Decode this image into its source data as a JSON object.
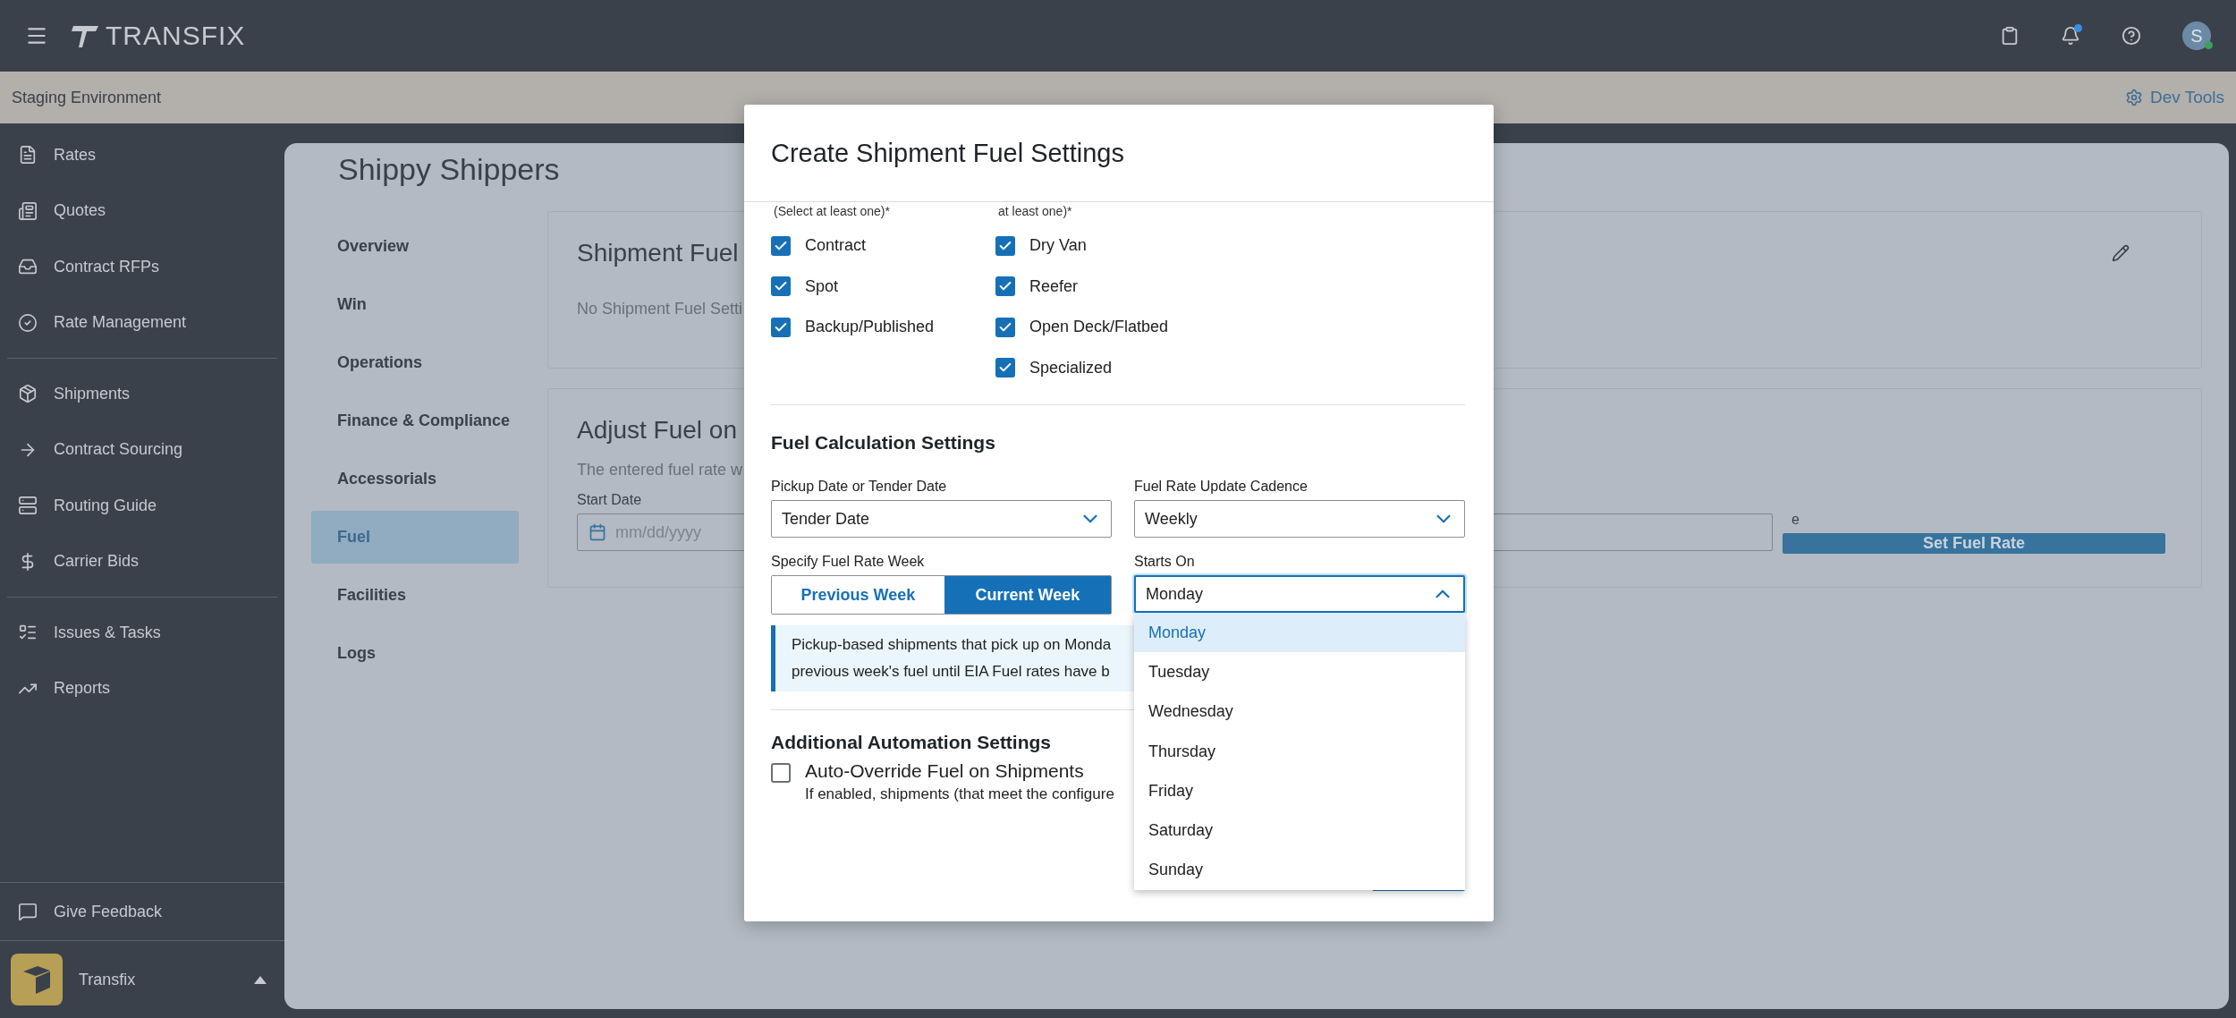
{
  "header": {
    "brand": "TRANSFIX",
    "notifications_unread": true,
    "avatar": {
      "initial": "S",
      "online": true
    }
  },
  "env_bar": {
    "label": "Staging Environment",
    "dev_tools": "Dev Tools"
  },
  "sidebar": {
    "groups": [
      [
        {
          "label": "Rates"
        },
        {
          "label": "Quotes"
        },
        {
          "label": "Contract RFPs"
        },
        {
          "label": "Rate Management"
        }
      ],
      [
        {
          "label": "Shipments"
        },
        {
          "label": "Contract Sourcing"
        },
        {
          "label": "Routing Guide"
        },
        {
          "label": "Carrier Bids"
        }
      ],
      [
        {
          "label": "Issues & Tasks"
        },
        {
          "label": "Reports"
        }
      ]
    ],
    "feedback": "Give Feedback",
    "account": {
      "name": "Transfix",
      "expanded": true
    }
  },
  "page": {
    "title": "Shippy Shippers",
    "tabs": [
      {
        "label": "Overview",
        "selected": false
      },
      {
        "label": "Win",
        "selected": false
      },
      {
        "label": "Operations",
        "selected": false
      },
      {
        "label": "Finance & Compliance",
        "selected": false
      },
      {
        "label": "Accessorials",
        "selected": false
      },
      {
        "label": "Fuel",
        "selected": true
      },
      {
        "label": "Facilities",
        "selected": false
      },
      {
        "label": "Logs",
        "selected": false
      }
    ],
    "settings_card": {
      "title": "Shipment Fuel",
      "empty_text": "No Shipment Fuel Setti"
    },
    "adjust_card": {
      "title": "Adjust Fuel on",
      "description": "The entered fuel rate w",
      "start_date_label": "Start Date",
      "start_date_placeholder": "mm/dd/yyyy",
      "column_2_label": "e",
      "button": "Set Fuel Rate"
    }
  },
  "modal": {
    "title": "Create Shipment Fuel Settings",
    "checkbox_columns": [
      {
        "hint": "(Select at least one)*",
        "options": [
          {
            "label": "Contract",
            "checked": true
          },
          {
            "label": "Spot",
            "checked": true
          },
          {
            "label": "Backup/Published",
            "checked": true
          }
        ]
      },
      {
        "hint": "at least one)*",
        "options": [
          {
            "label": "Dry Van",
            "checked": true
          },
          {
            "label": "Reefer",
            "checked": true
          },
          {
            "label": "Open Deck/Flatbed",
            "checked": true
          },
          {
            "label": "Specialized",
            "checked": true
          }
        ]
      }
    ],
    "calc_title": "Fuel Calculation Settings",
    "date_basis": {
      "label": "Pickup Date or Tender Date",
      "value": "Tender Date"
    },
    "cadence": {
      "label": "Fuel Rate Update Cadence",
      "value": "Weekly"
    },
    "rate_week": {
      "label": "Specify Fuel Rate Week",
      "options": [
        {
          "label": "Previous Week",
          "selected": false
        },
        {
          "label": "Current Week",
          "selected": true
        }
      ]
    },
    "starts_on": {
      "label": "Starts On",
      "value": "Monday",
      "expanded": true,
      "options": [
        {
          "label": "Monday",
          "selected": true
        },
        {
          "label": "Tuesday",
          "selected": false
        },
        {
          "label": "Wednesday",
          "selected": false
        },
        {
          "label": "Thursday",
          "selected": false
        },
        {
          "label": "Friday",
          "selected": false
        },
        {
          "label": "Saturday",
          "selected": false
        },
        {
          "label": "Sunday",
          "selected": false
        }
      ]
    },
    "info_lines": [
      "Pickup-based shipments that pick up on Monda",
      "previous week's fuel until EIA Fuel rates have b"
    ],
    "automation_title": "Additional Automation Settings",
    "auto_override": {
      "label": "Auto-Override Fuel on Shipments",
      "checked": false,
      "description": "If enabled, shipments (that meet the configure"
    }
  }
}
